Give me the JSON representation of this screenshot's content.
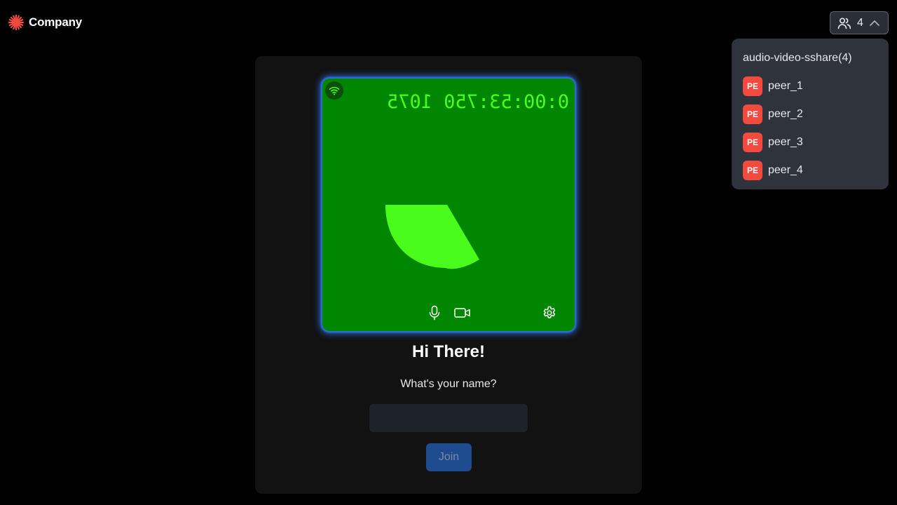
{
  "brand": {
    "name": "Company",
    "accent": "#f24a3f"
  },
  "header": {
    "participants_icon": "people-icon",
    "participants_count": "4",
    "chevron_icon": "chevron-up-icon"
  },
  "peer_list": {
    "room_name": "audio-video-sshare(4)",
    "peers": [
      {
        "initials": "PE",
        "name": "peer_1"
      },
      {
        "initials": "PE",
        "name": "peer_2"
      },
      {
        "initials": "PE",
        "name": "peer_3"
      },
      {
        "initials": "PE",
        "name": "peer_4"
      }
    ]
  },
  "preview": {
    "timecode": "0:00:53:750 1075",
    "network_icon": "wifi-icon",
    "controls": {
      "mic_icon": "microphone-icon",
      "camera_icon": "video-camera-icon",
      "settings_icon": "gear-icon"
    },
    "tile_color": "#008600",
    "glow_color": "#3b7ef5"
  },
  "form": {
    "greeting": "Hi There!",
    "prompt": "What's your name?",
    "name_value": "",
    "join_label": "Join"
  }
}
